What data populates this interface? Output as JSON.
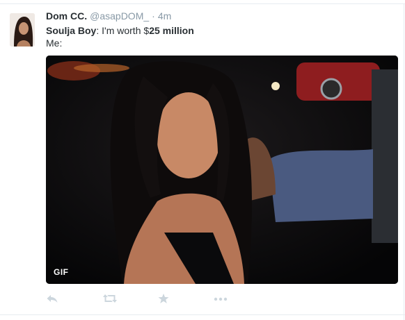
{
  "tweet": {
    "author": {
      "display_name": "Dom CC.",
      "handle": "@asapDOM_"
    },
    "separator": "·",
    "timestamp": "4m",
    "line1": {
      "name": "Soulja Boy",
      "rest_prefix": ": I'm worth ",
      "dollar": "$",
      "amount": "25 million"
    },
    "line2": "Me:",
    "media": {
      "badge": "GIF"
    }
  },
  "actions": [
    {
      "icon": "reply-icon"
    },
    {
      "icon": "retweet-icon"
    },
    {
      "icon": "favorite-star-icon"
    },
    {
      "icon": "more-dots-icon"
    }
  ],
  "colors": {
    "text": "#292f33",
    "muted": "#8899a6",
    "action_icon": "#ccd6dd",
    "border": "#e6ecf0",
    "media_bg": "#0b0b0d"
  }
}
